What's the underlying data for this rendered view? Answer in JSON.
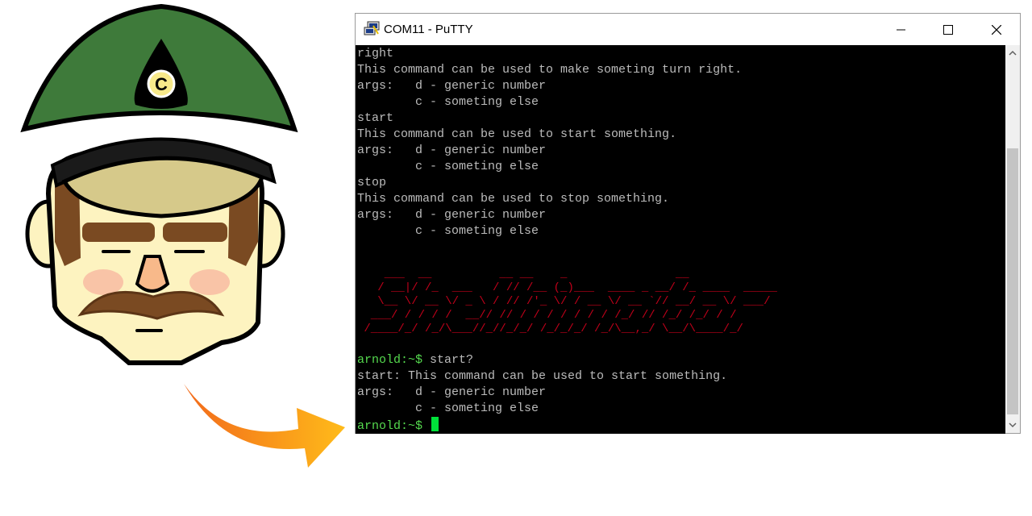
{
  "illustration": {
    "hat_letter": "C"
  },
  "window": {
    "title": "COM11 - PuTTY",
    "controls": {
      "minimize_icon": "minimize-icon",
      "maximize_icon": "maximize-icon",
      "close_icon": "close-icon"
    }
  },
  "terminal": {
    "lines": [
      "right",
      "This command can be used to make someting turn right.",
      "args:   d - generic number",
      "        c - someting else",
      "start",
      "This command can be used to start something.",
      "args:   d - generic number",
      "        c - someting else",
      "stop",
      "This command can be used to stop something.",
      "args:   d - generic number",
      "        c - someting else"
    ],
    "banner": "    ___  __          __ __    _                __                \n   / __|/ /_  ___   / // /__ (_)___  ____ _ __/ /_ ____  _____   \n   \\__ \\/ __ \\/ _ \\ / // /'_ \\/ / __ \\/ __ `// __/ __ \\/ ___/   \n  ___/ / / / /  __// // / / / / / / / /_/ // /_/ /_/ / /       \n /____/_/ /_/\\___//_//_/_/ /_/_/_/ /_/\\__,_/ \\__/\\____/_/        ",
    "banner_text": "Shellminator",
    "session": [
      {
        "prompt": "arnold:~$ ",
        "text": "start?"
      },
      {
        "prompt": "",
        "text": "start: This command can be used to start something."
      },
      {
        "prompt": "",
        "text": "args:   d - generic number"
      },
      {
        "prompt": "",
        "text": "        c - someting else"
      },
      {
        "prompt": "arnold:~$ ",
        "text": ""
      }
    ]
  },
  "colors": {
    "prompt": "#55d94e",
    "banner": "#c2001a",
    "cursor": "#00e23a",
    "text": "#bbbbbb"
  }
}
